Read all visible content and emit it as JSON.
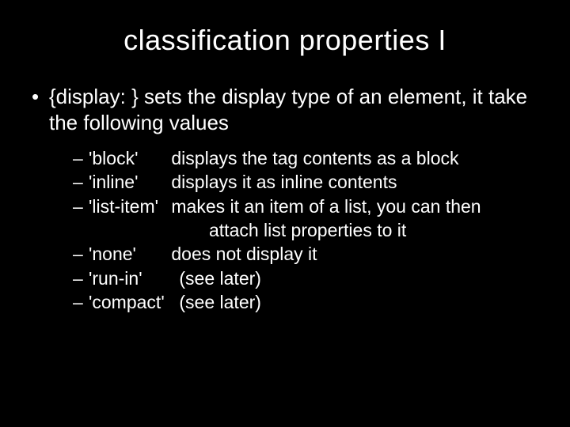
{
  "title": "classification properties I",
  "main_bullet": "{display: } sets the display type of an element, it take the following values",
  "items": [
    {
      "value": "'block'",
      "desc": "displays the tag contents as a block"
    },
    {
      "value": "'inline'",
      "desc": "displays it as inline contents"
    },
    {
      "value": "'list-item'",
      "desc": "makes it an item of a list, you can then",
      "cont": "attach list properties to it"
    },
    {
      "value": "'none'",
      "desc": "does not display it"
    },
    {
      "value": "'run-in'",
      "desc": "(see later)"
    },
    {
      "value": "'compact'",
      "desc": "(see later)"
    }
  ]
}
